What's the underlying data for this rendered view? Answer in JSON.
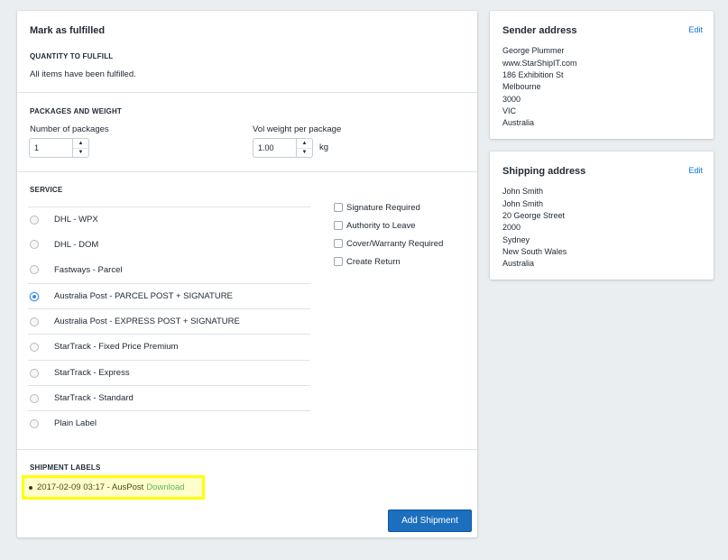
{
  "fulfill": {
    "title": "Mark as fulfilled",
    "quantity_heading": "QUANTITY TO FULFILL",
    "quantity_message": "All items have been fulfilled."
  },
  "packages": {
    "heading": "PACKAGES AND WEIGHT",
    "num_packages_label": "Number of packages",
    "num_packages_value": "1",
    "vol_weight_label": "Vol weight per package",
    "vol_weight_value": "1.00",
    "unit": "kg"
  },
  "service": {
    "heading": "SERVICE",
    "selected": "Australia Post - PARCEL POST + SIGNATURE",
    "options": [
      "DHL - WPX",
      "DHL - DOM",
      "Fastways - Parcel",
      "Australia Post - PARCEL POST + SIGNATURE",
      "Australia Post - EXPRESS POST + SIGNATURE",
      "StarTrack - Fixed Price Premium",
      "StarTrack - Express",
      "StarTrack - Standard",
      "Plain Label"
    ],
    "extras": [
      {
        "label": "Signature Required",
        "checked": false
      },
      {
        "label": "Authority to Leave",
        "checked": false
      },
      {
        "label": "Cover/Warranty Required",
        "checked": false
      },
      {
        "label": "Create Return",
        "checked": false
      }
    ]
  },
  "labels": {
    "heading": "SHIPMENT LABELS",
    "items": [
      {
        "text": "2017-02-09 03:17 - AusPost",
        "link": "Download"
      }
    ],
    "highlight_color": "#ffff00"
  },
  "actions": {
    "add_shipment": "Add Shipment",
    "primary_color": "#1c6fbf"
  },
  "sender": {
    "title": "Sender address",
    "edit": "Edit",
    "lines": [
      "George Plummer",
      "www.StarShipIT.com",
      "186 Exhibition St",
      "Melbourne",
      "3000",
      "VIC",
      "Australia"
    ]
  },
  "shipping": {
    "title": "Shipping address",
    "edit": "Edit",
    "lines": [
      "John Smith",
      "John Smith",
      "20 George Street",
      "2000",
      "Sydney",
      "New South Wales",
      "Australia"
    ]
  },
  "icons": {
    "up": "▲",
    "down": "▼"
  }
}
